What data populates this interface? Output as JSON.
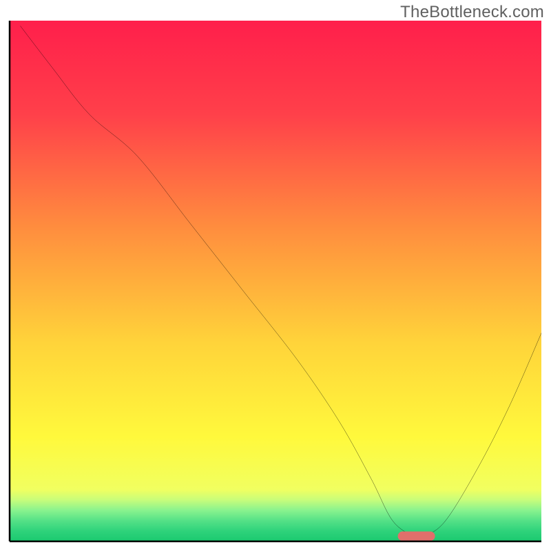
{
  "watermark": "TheBottleneck.com",
  "chart_data": {
    "type": "line",
    "title": "",
    "xlabel": "",
    "ylabel": "",
    "xlim": [
      0,
      100
    ],
    "ylim": [
      0,
      100
    ],
    "grid": false,
    "gradient_stops": [
      {
        "pos": 0,
        "color": "#ff1f4b"
      },
      {
        "pos": 18,
        "color": "#ff404a"
      },
      {
        "pos": 40,
        "color": "#ff8e3e"
      },
      {
        "pos": 62,
        "color": "#ffd43a"
      },
      {
        "pos": 80,
        "color": "#fff93c"
      },
      {
        "pos": 90,
        "color": "#f1ff60"
      },
      {
        "pos": 92,
        "color": "#c9fd7a"
      },
      {
        "pos": 94,
        "color": "#8af38e"
      },
      {
        "pos": 96,
        "color": "#55e187"
      },
      {
        "pos": 98,
        "color": "#2fd37b"
      },
      {
        "pos": 100,
        "color": "#1ac96f"
      }
    ],
    "series": [
      {
        "name": "bottleneck-curve",
        "x": [
          2,
          8,
          15,
          24,
          34,
          44,
          54,
          62,
          68,
          72,
          76,
          78,
          82,
          88,
          94,
          100
        ],
        "y": [
          99,
          91,
          82,
          74,
          61,
          48,
          35,
          23,
          12,
          4,
          1,
          1,
          4,
          14,
          26,
          40
        ]
      }
    ],
    "highlight": {
      "name": "optimal-range",
      "x_start": 73,
      "x_end": 80,
      "y": 1,
      "color": "#e06f6b"
    }
  }
}
